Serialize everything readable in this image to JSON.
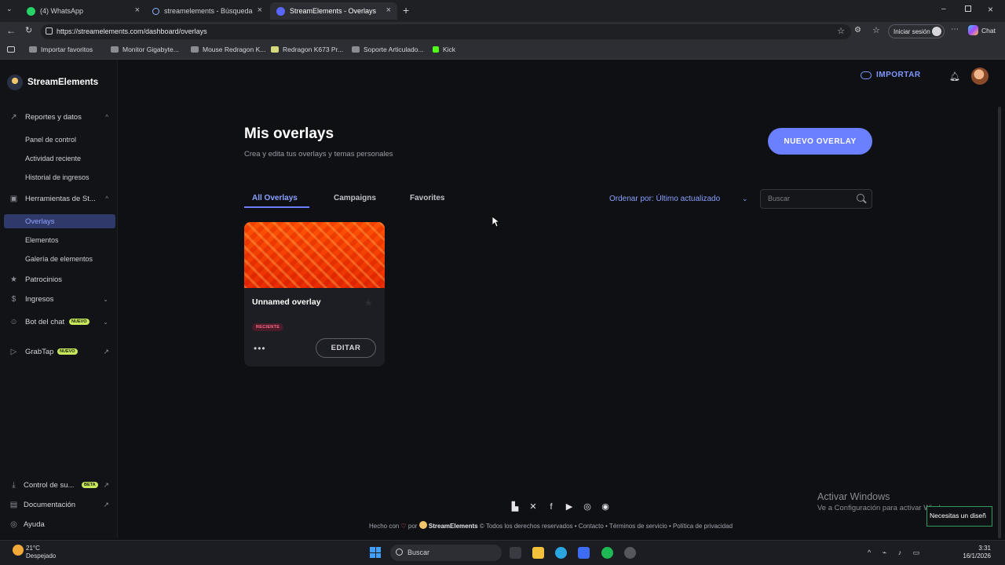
{
  "browser": {
    "tabs": [
      {
        "label": "(4) WhatsApp"
      },
      {
        "label": "streamelements - Búsqueda"
      },
      {
        "label": "StreamElements - Overlays"
      }
    ],
    "url": "https://streamelements.com/dashboard/overlays",
    "signin_label": "Iniciar sesión",
    "chat_label": "Chat",
    "bookmarks": [
      {
        "label": "Importar favoritos"
      },
      {
        "label": "Monitor Gigabyte..."
      },
      {
        "label": "Mouse Redragon K..."
      },
      {
        "label": "Redragon K673 Pr..."
      },
      {
        "label": "Soporte Articulado..."
      },
      {
        "label": "Kick"
      }
    ]
  },
  "app": {
    "brand": "StreamElements",
    "header": {
      "import_label": "IMPORTAR"
    },
    "sidebar": {
      "sections": [
        {
          "label": "Reportes y datos"
        },
        {
          "label": "Panel de control"
        },
        {
          "label": "Actividad reciente"
        },
        {
          "label": "Historial de ingresos"
        },
        {
          "label": "Herramientas de St..."
        },
        {
          "label": "Overlays"
        },
        {
          "label": "Elementos"
        },
        {
          "label": "Galería de elementos"
        },
        {
          "label": "Patrocinios"
        },
        {
          "label": "Ingresos"
        },
        {
          "label": "Bot del chat",
          "badge": "NUEVO"
        },
        {
          "label": "GrabTap",
          "badge": "NUEVO"
        }
      ],
      "bottom": [
        {
          "label": "Control de su...",
          "badge": "BETA"
        },
        {
          "label": "Documentación"
        },
        {
          "label": "Ayuda"
        }
      ]
    },
    "main": {
      "title": "Mis overlays",
      "subtitle": "Crea y edita tus overlays y temas personales",
      "new_button": "NUEVO OVERLAY",
      "tabs": [
        "All Overlays",
        "Campaigns",
        "Favorites"
      ],
      "sort_label": "Ordenar por: Último actualizado",
      "search_placeholder": "Buscar",
      "card": {
        "title": "Unnamed overlay",
        "tag": "RECIENTE",
        "more": "•••",
        "edit_label": "EDITAR"
      }
    },
    "footer": {
      "made_with": "Hecho con",
      "by": "por",
      "brand": "StreamElements",
      "rights": "© Todos los derechos reservados • Contacto • Términos de servicio • Política de privacidad"
    }
  },
  "windows": {
    "activate_title": "Activar Windows",
    "activate_sub": "Ve a Configuración para activar Windows.",
    "popup_text": "Necesitas un diseñ",
    "weather_temp": "21°C",
    "weather_desc": "Despejado",
    "taskbar_search": "Buscar",
    "time": "3:31",
    "date": "16/1/2026"
  },
  "colors": {
    "accent": "#6a80ff",
    "sidebar_active_bg": "#2f3a6a",
    "card_thumbnail": "#f26d10"
  }
}
